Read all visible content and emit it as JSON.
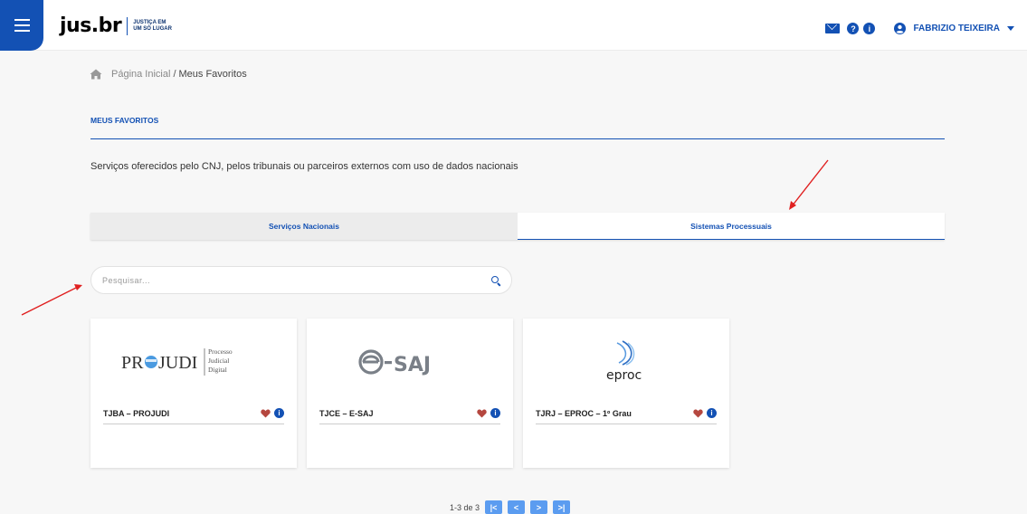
{
  "header": {
    "logo_text": "jus.br",
    "logo_tagline_1": "JUSTIÇA EM",
    "logo_tagline_2": "UM SÓ LUGAR",
    "user_name": "FABRIZIO TEIXEIRA",
    "help_glyph": "?",
    "info_glyph": "i",
    "icons": [
      "menu-icon",
      "mail-icon",
      "help-icon",
      "info-icon",
      "user-icon",
      "caret-down-icon"
    ],
    "brand_color": "#1351b4"
  },
  "breadcrumb": {
    "home": "Página Inicial",
    "separator": "/",
    "current": "Meus Favoritos"
  },
  "section": {
    "title": "MEUS FAVORITOS",
    "description": "Serviços oferecidos pelo CNJ, pelos tribunais ou parceiros externos com uso de dados nacionais"
  },
  "tabs": [
    {
      "label": "Serviços Nacionais",
      "active": false
    },
    {
      "label": "Sistemas Processuais",
      "active": true
    }
  ],
  "search": {
    "placeholder": "Pesquisar...",
    "value": ""
  },
  "cards": [
    {
      "label": "TJBA – PROJUDI",
      "logo": "PROJUDI",
      "logo_sub": [
        "Processo",
        "Judicial",
        "Digital"
      ],
      "favorite": true
    },
    {
      "label": "TJCE – E-SAJ",
      "logo": "e-SAJ",
      "favorite": true
    },
    {
      "label": "TJRJ – EPROC – 1º Grau",
      "logo": "eproc",
      "favorite": true
    }
  ],
  "pagination": {
    "summary": "1-3 de 3",
    "first": "|<",
    "prev": "<",
    "next": ">",
    "last": ">|"
  },
  "annotation_color": "#e02020"
}
